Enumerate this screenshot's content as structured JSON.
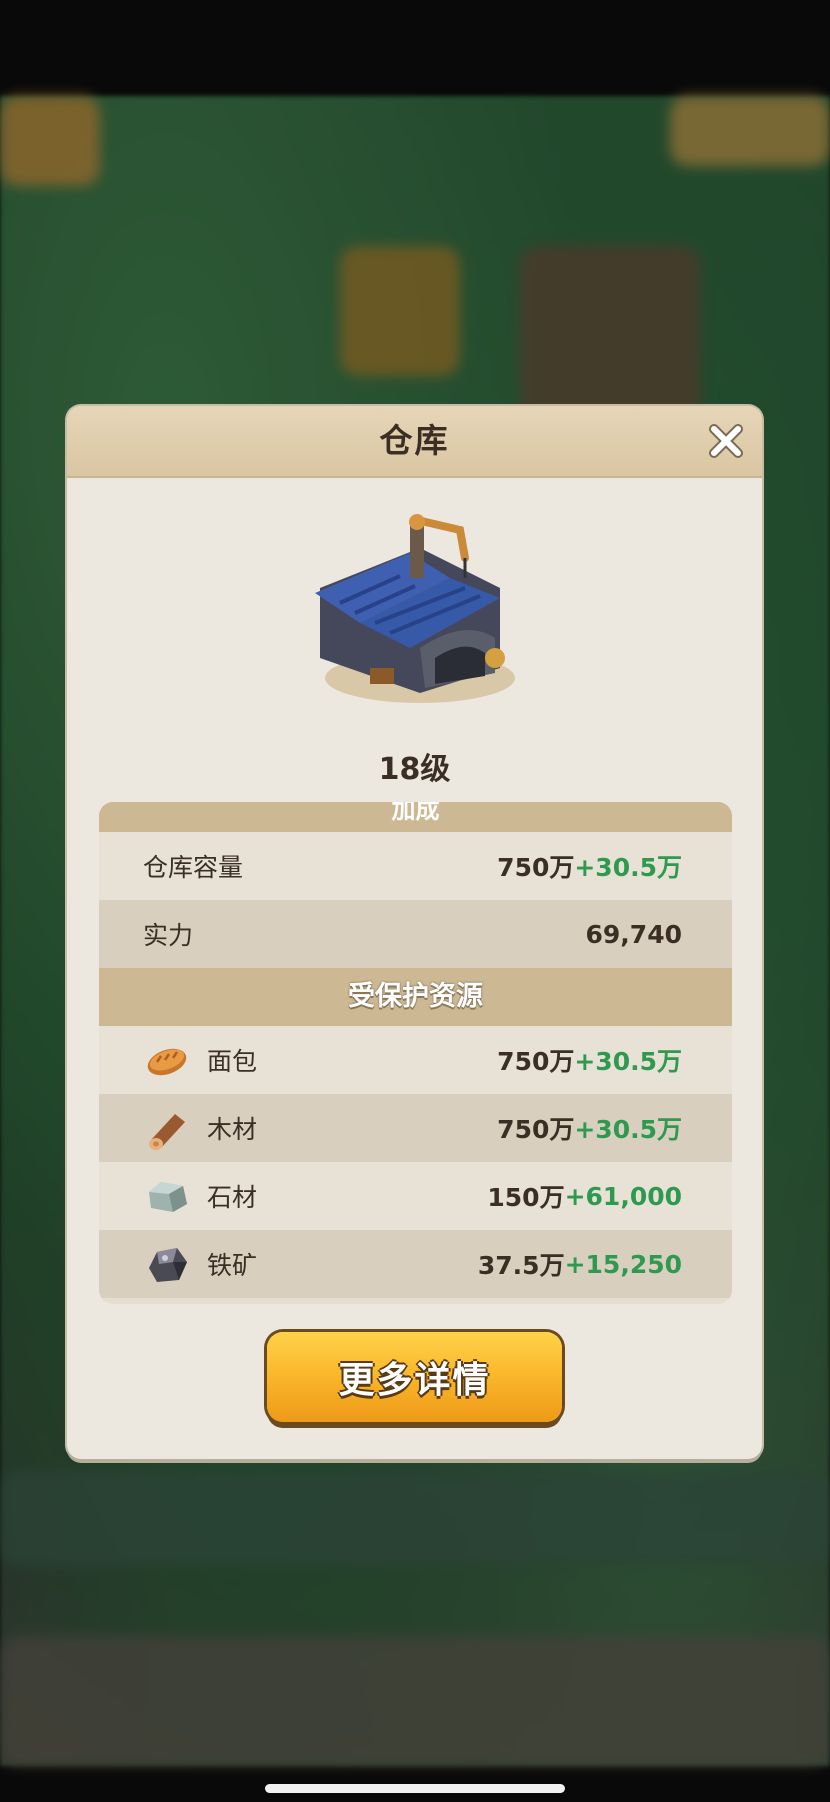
{
  "dialog": {
    "title": "仓库",
    "level": "18级",
    "bonus_section": "加成",
    "stats": [
      {
        "label": "仓库容量",
        "value": "750万",
        "bonus": "+30.5万"
      },
      {
        "label": "实力",
        "value": "69,740",
        "bonus": ""
      }
    ],
    "protected_section": "受保护资源",
    "resources": [
      {
        "icon": "bread-icon",
        "label": "面包",
        "value": "750万",
        "bonus": "+30.5万"
      },
      {
        "icon": "wood-icon",
        "label": "木材",
        "value": "750万",
        "bonus": "+30.5万"
      },
      {
        "icon": "stone-icon",
        "label": "石材",
        "value": "150万",
        "bonus": "+61,000"
      },
      {
        "icon": "iron-ore-icon",
        "label": "铁矿",
        "value": "37.5万",
        "bonus": "+15,250"
      }
    ],
    "more_button": "更多详情"
  },
  "colors": {
    "bonus_green": "#2f9a4f",
    "header_tan": "#cdb894",
    "button_orange": "#f9b62a"
  }
}
